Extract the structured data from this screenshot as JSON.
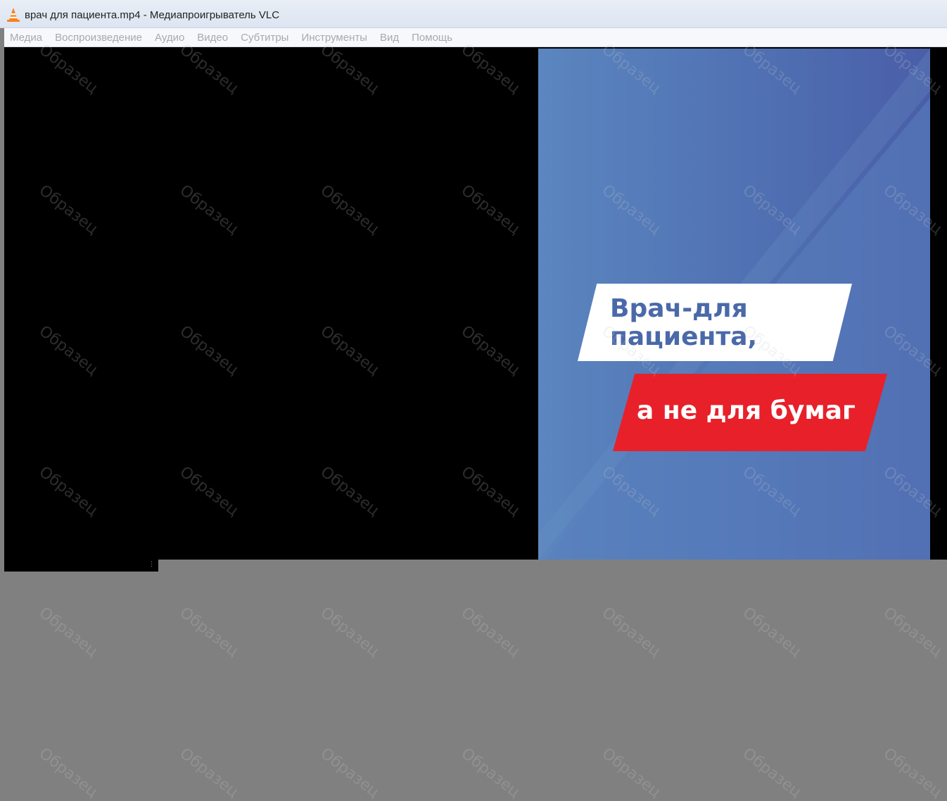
{
  "window": {
    "title": "врач для пациента.mp4 - Медиапроигрыватель VLC"
  },
  "menu": {
    "items": [
      {
        "id": "media",
        "label": "Медиа"
      },
      {
        "id": "playback",
        "label": "Воспроизведение"
      },
      {
        "id": "audio",
        "label": "Аудио"
      },
      {
        "id": "video",
        "label": "Видео"
      },
      {
        "id": "subtitles",
        "label": "Субтитры"
      },
      {
        "id": "tools",
        "label": "Инструменты"
      },
      {
        "id": "view",
        "label": "Вид"
      },
      {
        "id": "help",
        "label": "Помощь"
      }
    ]
  },
  "poster": {
    "line1": "Врач-для\nпациента,",
    "line2": "а не для бумаг"
  },
  "watermark": {
    "text": "Образец"
  },
  "colors": {
    "poster_blue": "#4f6fb2",
    "banner_red": "#e8202a",
    "banner_text_blue": "#4a69a9",
    "desktop_gray": "#808080"
  }
}
